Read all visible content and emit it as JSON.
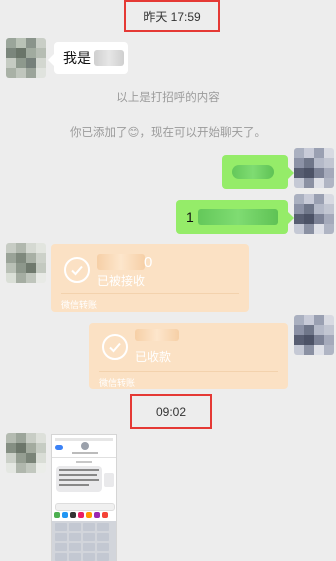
{
  "timestamps": {
    "first": "昨天 17:59",
    "second": "09:02"
  },
  "messages": {
    "greeting": "我是",
    "own_message": "1"
  },
  "system": {
    "hello_content": "以上是打招呼的内容",
    "added_notice": "你已添加了😊，现在可以开始聊天了。"
  },
  "transfers": {
    "received_card": {
      "status": "已被接收",
      "amount_visible": "0",
      "footer": "微信转账"
    },
    "collected_card": {
      "status": "已收款",
      "footer": "微信转账"
    }
  },
  "icons": {
    "check": "check-icon"
  },
  "colors": {
    "own_bubble": "#95ec69",
    "other_bubble": "#ffffff",
    "transfer_card": "#fbe1c4",
    "highlight_border": "#e53935",
    "background": "#ededed"
  }
}
